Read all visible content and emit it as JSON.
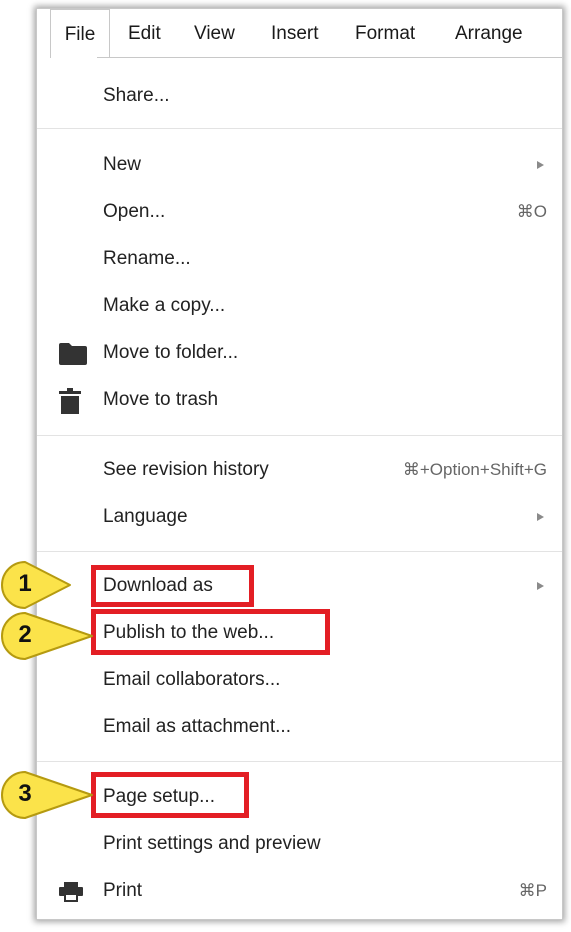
{
  "menubar": {
    "items": [
      "File",
      "Edit",
      "View",
      "Insert",
      "Format",
      "Arrange"
    ],
    "active": "File"
  },
  "file_menu": {
    "share": "Share...",
    "new": "New",
    "open": "Open...",
    "open_shortcut": "⌘O",
    "rename": "Rename...",
    "make_copy": "Make a copy...",
    "move_to_folder": "Move to folder...",
    "move_to_trash": "Move to trash",
    "revision_history": "See revision history",
    "revision_history_shortcut": "⌘+Option+Shift+G",
    "language": "Language",
    "download_as": "Download as",
    "publish_web": "Publish to the web...",
    "email_collaborators": "Email collaborators...",
    "email_attachment": "Email as attachment...",
    "page_setup": "Page setup...",
    "print_settings": "Print settings and preview",
    "print": "Print",
    "print_shortcut": "⌘P"
  },
  "callouts": [
    "1",
    "2",
    "3"
  ],
  "colors": {
    "highlight": "#e31e24",
    "callout_fill": "#fbe34a",
    "callout_stroke": "#b59a10"
  },
  "icons": {
    "folder": "folder-icon",
    "trash": "trash-icon",
    "print": "printer-icon",
    "submenu": "submenu-arrow-icon"
  }
}
